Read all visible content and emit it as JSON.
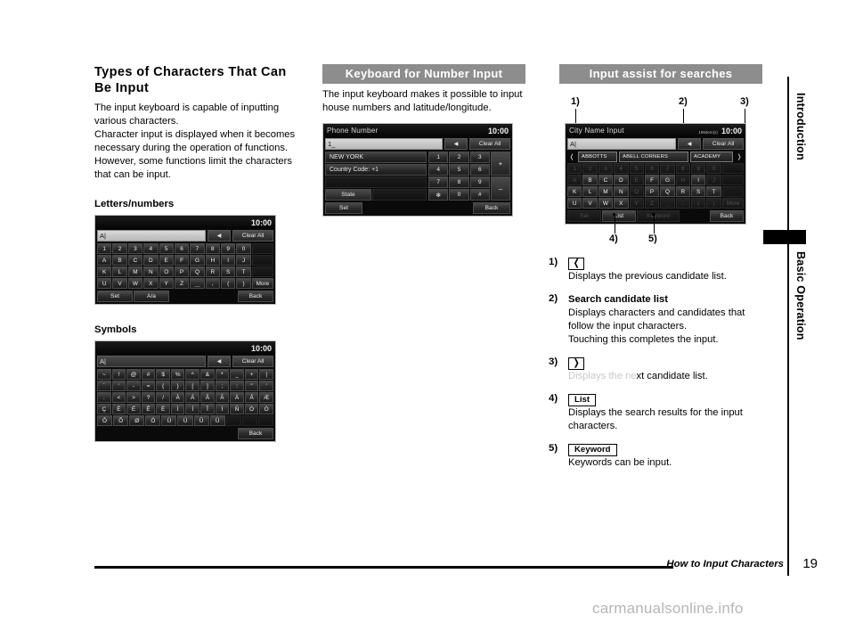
{
  "document": {
    "footer_title": "How to Input Characters",
    "page_number": "19",
    "watermark": "carmanualsonline.info"
  },
  "side_tabs": [
    {
      "label": "Introduction"
    },
    {
      "label": "Basic Operation"
    }
  ],
  "col1": {
    "heading": "Types of Characters That Can Be Input",
    "paragraph": "The input keyboard is capable of inputting various characters.\nCharacter input is displayed when it becomes necessary during the operation of functions.\nHowever, some functions limit the characters that can be input.",
    "sub1": "Letters/numbers",
    "sub2": "Symbols"
  },
  "col2": {
    "bar_title": "Keyboard for Number Input",
    "paragraph": "The input keyboard makes it possible to input house numbers and latitude/longitude."
  },
  "col3": {
    "bar_title": "Input assist for searches",
    "callouts": [
      "1)",
      "2)",
      "3)",
      "4)",
      "5)"
    ]
  },
  "letters_screen": {
    "title": "",
    "clock": "10:00",
    "input_value": "A|",
    "backspace_label": "◀",
    "clear_all_label": "Clear All",
    "rows": [
      [
        "1",
        "2",
        "3",
        "4",
        "5",
        "6",
        "7",
        "8",
        "9",
        "0"
      ],
      [
        "A",
        "B",
        "C",
        "D",
        "E",
        "F",
        "G",
        "H",
        "I",
        "J"
      ],
      [
        "K",
        "L",
        "M",
        "N",
        "O",
        "P",
        "Q",
        "R",
        "S",
        "T"
      ],
      [
        "U",
        "V",
        "W",
        "X",
        "Y",
        "Z",
        "＿",
        ",",
        "(",
        ")"
      ]
    ],
    "more_label": "More",
    "set_label": "Set",
    "case_label": "A/a",
    "back_label": "Back"
  },
  "symbols_screen": {
    "clock": "10:00",
    "input_value": "A|",
    "backspace_label": "◀",
    "clear_all_label": "Clear All",
    "rows": [
      [
        "~",
        "!",
        "@",
        "#",
        "$",
        "%",
        "^",
        "&",
        "*",
        "_",
        "+",
        "|"
      ],
      [
        "`",
        "'",
        "-",
        "=",
        "{",
        "}",
        "[",
        "]",
        ";",
        ":",
        "\"",
        "'"
      ],
      [
        ".",
        "<",
        ">",
        "?",
        "/",
        "À",
        "Á",
        "Â",
        "Ã",
        "Ä",
        "Å",
        "Æ"
      ],
      [
        "Ç",
        "È",
        "É",
        "Ê",
        "Ë",
        "Ì",
        "Í",
        "Î",
        "Ï",
        "Ñ",
        "Ò",
        "Ó"
      ],
      [
        "Ô",
        "Õ",
        "Ø",
        "Ö",
        "Ù",
        "Ú",
        "Û",
        "Ü",
        "",
        "",
        ""
      ]
    ],
    "back_label": "Back"
  },
  "number_screen": {
    "title": "Phone Number",
    "clock": "10:00",
    "input_value": "1_",
    "backspace_label": "◀",
    "clear_all_label": "Clear All",
    "line1": "NEW YORK",
    "line2": "Country Code: +1",
    "line3": "",
    "state_label": "State",
    "digit_rows": [
      [
        "1",
        "2",
        "3"
      ],
      [
        "4",
        "5",
        "6"
      ],
      [
        "7",
        "8",
        "9"
      ],
      [
        "✻",
        "0",
        "#"
      ]
    ],
    "op_plus": "+",
    "op_minus": "–",
    "set_label": "Set",
    "back_label": "Back"
  },
  "assist_screen": {
    "title": "City Name Input",
    "item_count": "195item(s)",
    "clock": "10:00",
    "input_value": "A|",
    "backspace_label": "◀",
    "clear_all_label": "Clear All",
    "prev_arrow": "❬",
    "next_arrow": "❭",
    "candidates": [
      "ABBOTTS",
      "ABELL CORNERS",
      "ACADEMY"
    ],
    "rows": [
      [
        "1",
        "2",
        "3",
        "4",
        "5",
        "6",
        "7",
        "8",
        "9",
        "0"
      ],
      [
        "A",
        "B",
        "C",
        "D",
        "E",
        "F",
        "G",
        "H",
        "I",
        "J"
      ],
      [
        "K",
        "L",
        "M",
        "N",
        "O",
        "P",
        "Q",
        "R",
        "S",
        "T"
      ],
      [
        "U",
        "V",
        "W",
        "X",
        "Y",
        "Z",
        "＿",
        ",",
        "(",
        ")"
      ]
    ],
    "enabled_keys": [
      "B",
      "C",
      "D",
      "F",
      "G",
      "I",
      "K",
      "L",
      "M",
      "N",
      "P",
      "Q",
      "R",
      "S",
      "T",
      "U",
      "V",
      "W",
      "X"
    ],
    "more_label": "More",
    "set_label": "Set",
    "list_label": "List",
    "keyword_label": "Keyword",
    "back_label": "Back"
  },
  "explanations": [
    {
      "num": "1)",
      "chip": "❬",
      "chip_type": "arrow",
      "lines": [
        "Displays the previous candidate list."
      ]
    },
    {
      "num": "2)",
      "chip": "Search candidate list",
      "chip_type": "bold",
      "lines": [
        "Displays characters and candidates that follow the input characters.",
        "Touching this completes the input."
      ]
    },
    {
      "num": "3)",
      "chip": "❭",
      "chip_type": "arrow",
      "lines": [
        "Displays the next candidate list."
      ]
    },
    {
      "num": "4)",
      "chip": "List",
      "chip_type": "button",
      "lines": [
        "Displays the search results for the input characters."
      ]
    },
    {
      "num": "5)",
      "chip": "Keyword",
      "chip_type": "button",
      "lines": [
        "Keywords can be input."
      ]
    }
  ]
}
